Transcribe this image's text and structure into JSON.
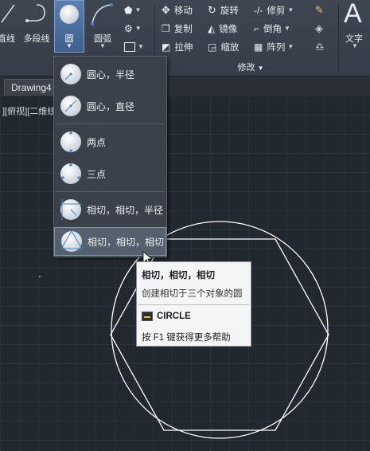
{
  "ribbon": {
    "line_label": "直线",
    "polyline_label": "多段线",
    "circle_label": "圆",
    "arc_label": "圆弧",
    "modify": {
      "move": "移动",
      "rotate": "旋转",
      "trim": "修剪",
      "copy": "复制",
      "mirror": "镜像",
      "fillet": "倒角",
      "stretch": "拉伸",
      "scale": "缩放",
      "array": "阵列",
      "panel_title": "修改"
    },
    "text_label": "文字",
    "text_glyph": "A"
  },
  "tabs": {
    "drawing": "Drawing4"
  },
  "viewport": {
    "label": "][俯视][二维线"
  },
  "circle_menu": {
    "items": [
      {
        "label": "圆心，半径",
        "icon": "circle-center-radius-icon"
      },
      {
        "label": "圆心，直径",
        "icon": "circle-center-diameter-icon"
      },
      {
        "label": "两点",
        "icon": "circle-2point-icon"
      },
      {
        "label": "三点",
        "icon": "circle-3point-icon"
      },
      {
        "label": "相切，相切，半径",
        "icon": "circle-ttr-icon"
      },
      {
        "label": "相切，相切，相切",
        "icon": "circle-ttt-icon",
        "selected": true
      }
    ]
  },
  "tooltip": {
    "title": "相切，相切，相切",
    "description": "创建相切于三个对象的圆",
    "command": "CIRCLE",
    "help": "按 F1 键获得更多帮助"
  },
  "colors": {
    "ribbon_bg": "#3a414c",
    "viewport_bg": "#212830",
    "accent": "#5b7fae"
  }
}
